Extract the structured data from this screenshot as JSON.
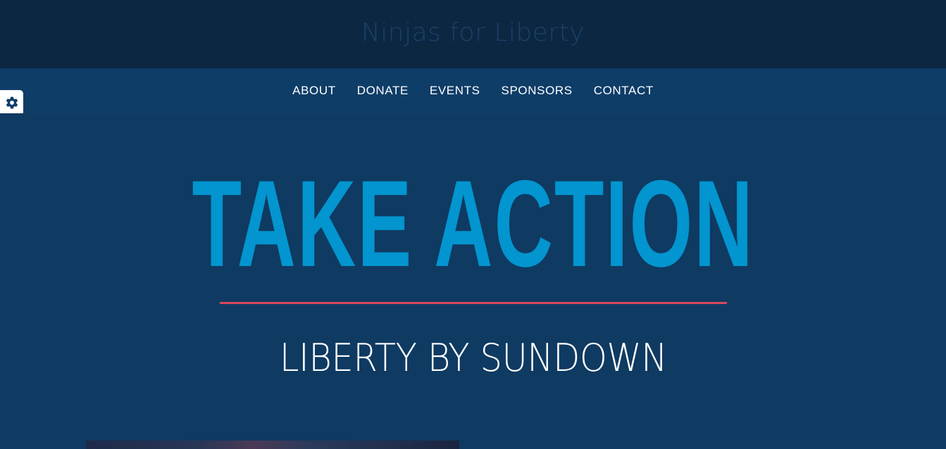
{
  "header": {
    "site_title": "Ninjas for Liberty"
  },
  "nav": {
    "items": [
      {
        "label": "ABOUT"
      },
      {
        "label": "DONATE"
      },
      {
        "label": "EVENTS"
      },
      {
        "label": "SPONSORS"
      },
      {
        "label": "CONTACT"
      }
    ]
  },
  "settings": {
    "icon": "gear-icon"
  },
  "hero": {
    "title": "TAKE ACTION",
    "subtitle": "LIBERTY BY SUNDOWN"
  },
  "colors": {
    "header_bg": "#0b2742",
    "nav_bg": "#0e3d68",
    "page_bg": "#0f3a62",
    "accent_blue": "#0295cf",
    "divider_red": "#d9475d"
  }
}
